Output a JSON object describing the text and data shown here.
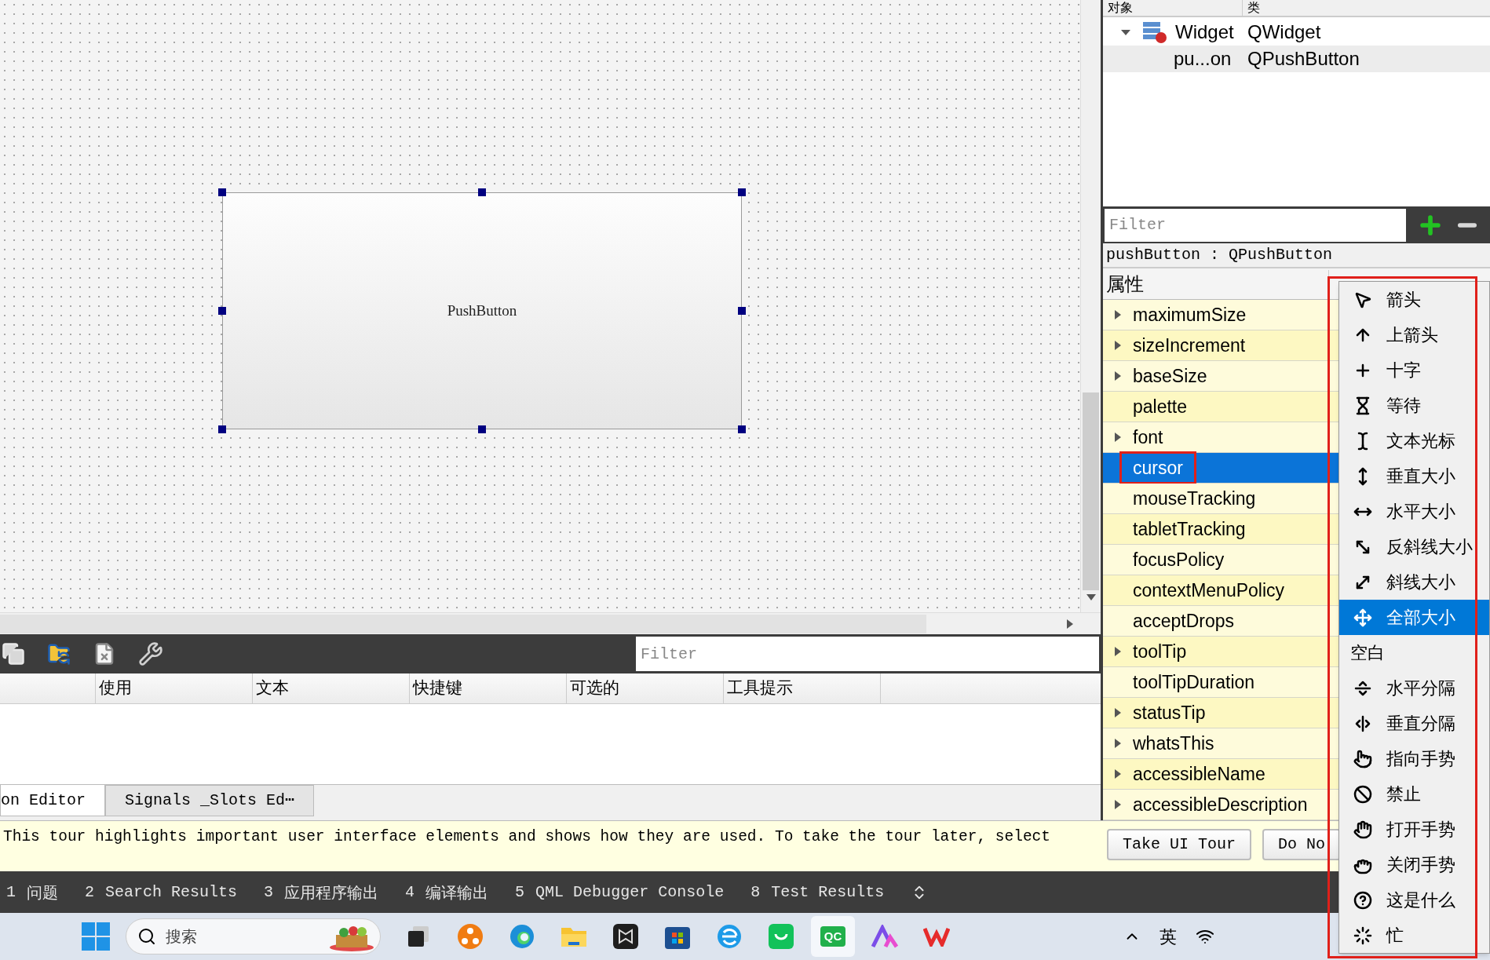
{
  "form_canvas": {
    "button_text": "PushButton"
  },
  "action_editor": {
    "filter_placeholder": "Filter",
    "columns": [
      "使用",
      "文本",
      "快捷键",
      "可选的",
      "工具提示"
    ]
  },
  "bottom_tabs": [
    {
      "label": "on Editor",
      "selected": true
    },
    {
      "label": "Signals _Slots Ed⋯",
      "selected": false
    }
  ],
  "object_inspector": {
    "columns": [
      "对象",
      "类"
    ],
    "objects": [
      {
        "name": "Widget",
        "class": "QWidget",
        "expanded": true,
        "selected": false,
        "children": [
          {
            "name": "pu...on",
            "class": "QPushButton",
            "selected": true
          }
        ]
      }
    ]
  },
  "property_editor": {
    "filter_placeholder": "Filter",
    "class_line": "pushButton : QPushButton",
    "column": "属性",
    "properties": [
      {
        "name": "maximumSize",
        "expandable": true,
        "selected": false
      },
      {
        "name": "sizeIncrement",
        "expandable": true,
        "selected": false
      },
      {
        "name": "baseSize",
        "expandable": true,
        "selected": false
      },
      {
        "name": "palette",
        "expandable": false,
        "selected": false
      },
      {
        "name": "font",
        "expandable": true,
        "selected": false
      },
      {
        "name": "cursor",
        "expandable": false,
        "selected": true
      },
      {
        "name": "mouseTracking",
        "expandable": false,
        "selected": false
      },
      {
        "name": "tabletTracking",
        "expandable": false,
        "selected": false
      },
      {
        "name": "focusPolicy",
        "expandable": false,
        "selected": false
      },
      {
        "name": "contextMenuPolicy",
        "expandable": false,
        "selected": false
      },
      {
        "name": "acceptDrops",
        "expandable": false,
        "selected": false
      },
      {
        "name": "toolTip",
        "expandable": true,
        "selected": false
      },
      {
        "name": "toolTipDuration",
        "expandable": false,
        "selected": false
      },
      {
        "name": "statusTip",
        "expandable": true,
        "selected": false
      },
      {
        "name": "whatsThis",
        "expandable": true,
        "selected": false
      },
      {
        "name": "accessibleName",
        "expandable": true,
        "selected": false
      },
      {
        "name": "accessibleDescription",
        "expandable": true,
        "selected": false
      }
    ]
  },
  "cursor_menu": {
    "items": [
      {
        "label": "箭头",
        "kind": "arrow",
        "selected": false
      },
      {
        "label": "上箭头",
        "kind": "up-arrow",
        "selected": false
      },
      {
        "label": "十字",
        "kind": "cross",
        "selected": false
      },
      {
        "label": "等待",
        "kind": "wait",
        "selected": false
      },
      {
        "label": "文本光标",
        "kind": "ibeam",
        "selected": false
      },
      {
        "label": "垂直大小",
        "kind": "size-vertical",
        "selected": false
      },
      {
        "label": "水平大小",
        "kind": "size-horizontal",
        "selected": false
      },
      {
        "label": "反斜线大小",
        "kind": "size-backslash",
        "selected": false
      },
      {
        "label": "斜线大小",
        "kind": "size-slash",
        "selected": false
      },
      {
        "label": "全部大小",
        "kind": "size-all",
        "selected": true
      },
      {
        "label": "空白",
        "kind": "blank",
        "selected": false
      },
      {
        "label": "水平分隔",
        "kind": "split-horizontal",
        "selected": false
      },
      {
        "label": "垂直分隔",
        "kind": "split-vertical",
        "selected": false
      },
      {
        "label": "指向手势",
        "kind": "pointing-hand",
        "selected": false
      },
      {
        "label": "禁止",
        "kind": "forbidden",
        "selected": false
      },
      {
        "label": "打开手势",
        "kind": "open-hand",
        "selected": false
      },
      {
        "label": "关闭手势",
        "kind": "closed-hand",
        "selected": false
      },
      {
        "label": "这是什么",
        "kind": "whats-this",
        "selected": false
      },
      {
        "label": "忙",
        "kind": "busy",
        "selected": false
      }
    ]
  },
  "annotations": {
    "frame_selected_property": true,
    "frame_menu": true
  },
  "tour_bar": {
    "message": "This tour highlights important user interface elements and shows how they are used. To take the tour later, select",
    "buttons": [
      "Take UI Tour",
      "Do No"
    ]
  },
  "output_panes": [
    {
      "number": "1",
      "label": "问题"
    },
    {
      "number": "2",
      "label": "Search Results"
    },
    {
      "number": "3",
      "label": "应用程序输出"
    },
    {
      "number": "4",
      "label": "编译输出"
    },
    {
      "number": "5",
      "label": "QML Debugger Console"
    },
    {
      "number": "8",
      "label": "Test Results"
    }
  ],
  "taskbar": {
    "search_placeholder": "搜索",
    "apps": [
      {
        "kind": "task-view",
        "selected": false
      },
      {
        "kind": "orange",
        "selected": false
      },
      {
        "kind": "edge",
        "selected": false
      },
      {
        "kind": "folder",
        "selected": false
      },
      {
        "kind": "dark",
        "selected": false
      },
      {
        "kind": "store",
        "selected": false
      },
      {
        "kind": "blue-e",
        "selected": false
      },
      {
        "kind": "green",
        "selected": false
      },
      {
        "kind": "qc",
        "label": "QC",
        "selected": true
      },
      {
        "kind": "purple",
        "selected": false
      },
      {
        "kind": "wps",
        "selected": false
      }
    ],
    "language": "英"
  }
}
